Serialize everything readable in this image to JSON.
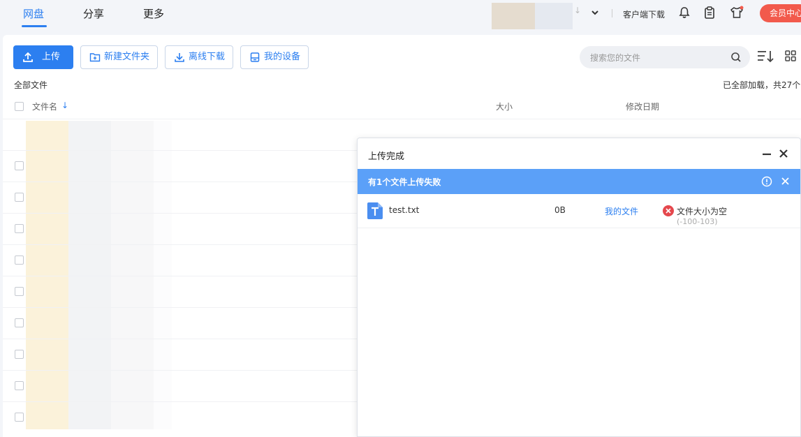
{
  "nav": {
    "tabs": [
      {
        "label": "网盘",
        "active": true
      },
      {
        "label": "分享",
        "active": false
      },
      {
        "label": "更多",
        "active": false
      }
    ],
    "client_download": "客户端下载",
    "vip_center": "会员中心"
  },
  "toolbar": {
    "upload": "上传",
    "new_folder": "新建文件夹",
    "offline_download": "离线下载",
    "my_devices": "我的设备",
    "search_placeholder": "搜索您的文件"
  },
  "list": {
    "breadcrumb": "全部文件",
    "loaded_status": "已全部加载，共27个",
    "columns": {
      "name": "文件名",
      "size": "大小",
      "modified": "修改日期"
    }
  },
  "upload_dialog": {
    "title": "上传完成",
    "fail_banner": "有1个文件上传失败",
    "files": [
      {
        "name": "test.txt",
        "size": "0B",
        "location": "我的文件",
        "error": "文件大小为空",
        "error_code": "(-100-103)"
      }
    ]
  },
  "colors": {
    "accent": "#2c7ff0",
    "banner": "#5ba0f8",
    "error": "#e5484d",
    "vip": "#f25a4c"
  }
}
